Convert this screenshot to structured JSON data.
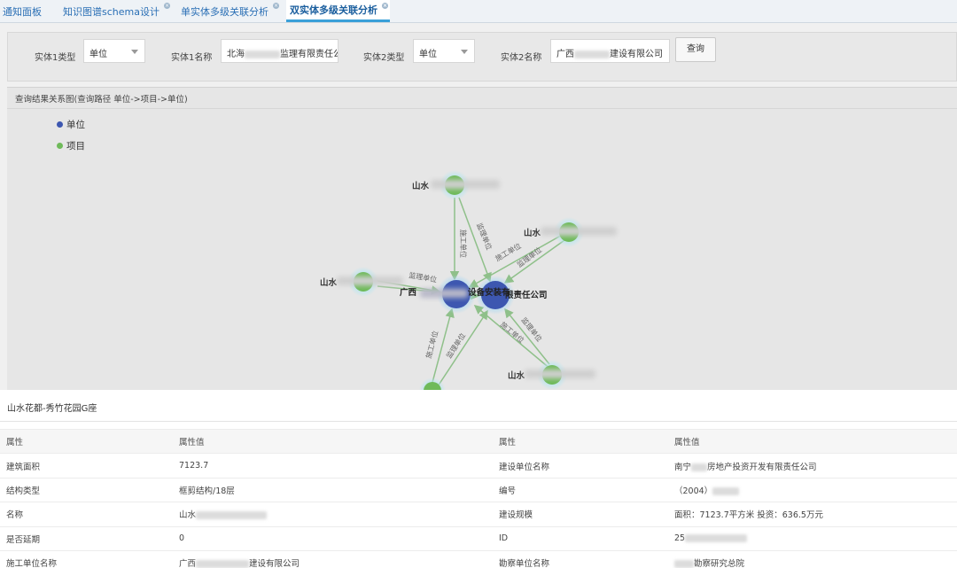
{
  "tabs": [
    {
      "label": "通知面板",
      "closable": false,
      "active": false
    },
    {
      "label": "知识图谱schema设计",
      "closable": true,
      "active": false
    },
    {
      "label": "单实体多级关联分析",
      "closable": true,
      "active": false
    },
    {
      "label": "双实体多级关联分析",
      "closable": true,
      "active": true
    }
  ],
  "filters": {
    "entity1_type_label": "实体1类型",
    "entity1_type_value": "单位",
    "entity1_name_label": "实体1名称",
    "entity1_name_value_start": "北海",
    "entity1_name_value_end": "监理有限责任公",
    "entity2_type_label": "实体2类型",
    "entity2_type_value": "单位",
    "entity2_name_label": "实体2名称",
    "entity2_name_value_start": "广西",
    "entity2_name_value_end": "建设有限公司",
    "query_button": "查询"
  },
  "graph": {
    "title": "查询结果关系图(查询路径 单位->项目->单位)",
    "legend": [
      {
        "label": "单位",
        "color": "#3d57b0"
      },
      {
        "label": "项目",
        "color": "#6fba5a"
      }
    ],
    "center_label_left": "广西",
    "center_label_mid": "设备安装有",
    "center_label_right": "限责任公司",
    "node_labels": {
      "top": "山水",
      "right_top": "山水",
      "left": "山水",
      "bottom_right": "山水"
    },
    "edge_labels": {
      "construction": "施工单位",
      "supervision": "监理单位"
    },
    "colors": {
      "unit_node": "#3d57b0",
      "project_node": "#6fba5a",
      "edge": "#8fc08a"
    }
  },
  "detail": {
    "title": "山水花都-秀竹花园G座",
    "headers": [
      "属性",
      "属性值",
      "属性",
      "属性值"
    ],
    "rows": [
      {
        "k1": "建筑面积",
        "v1": "7123.7",
        "k2": "建设单位名称",
        "v2_start": "南宁",
        "v2_end": "房地产投资开发有限责任公司"
      },
      {
        "k1": "结构类型",
        "v1": "框剪结构/18层",
        "k2": "编号",
        "v2_start": "（2004）",
        "v2_end": ""
      },
      {
        "k1": "名称",
        "v1": "山水",
        "k2": "建设规模",
        "v2_start": "面积：7123.7平方米 投资：636.5万元",
        "v2_end": ""
      },
      {
        "k1": "是否延期",
        "v1": "0",
        "k2": "ID",
        "v2_start": "25",
        "v2_end": ""
      },
      {
        "k1": "施工单位名称",
        "v1": "广西",
        "v1_end": "建设有限公司",
        "k2": "勘察单位名称",
        "v2_start": "",
        "v2_end": "勘察研究总院"
      }
    ]
  }
}
